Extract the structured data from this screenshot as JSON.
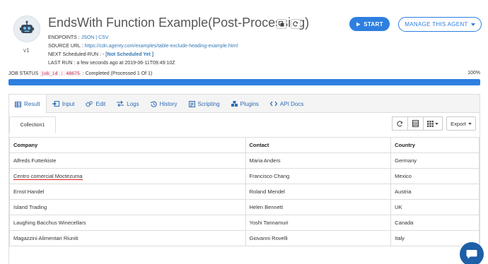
{
  "header": {
    "version": "v1",
    "title": "EndsWith Function Example(Post-Processing)",
    "endpoints_label": "ENDPOINTS :",
    "endpoints_json": "JSON",
    "endpoints_sep": " | ",
    "endpoints_csv": "CSV",
    "source_label": "SOURCE URL :",
    "source_url": "https://cdn.agenty.com/examples/table-exclude-heading-example.html",
    "next_label": "NEXT Scheduled-RUN : -",
    "next_value": "[Not Scheduled Yet ]",
    "last_label": "LAST RUN :",
    "last_value": "a few seconds ago at 2019-06-11T09:49:10Z",
    "start_label": "START",
    "manage_label": "MANAGE THIS AGENT"
  },
  "job": {
    "status_label": "JOB STATUS",
    "job_id": "job_id : 48675",
    "status_text": ": Completed (Processed 1 Of 1)",
    "percent": "100%",
    "progress": 1.0
  },
  "tabs": [
    {
      "label": "Result",
      "icon": "table-icon"
    },
    {
      "label": "Input",
      "icon": "input-icon"
    },
    {
      "label": "Edit",
      "icon": "gears-icon"
    },
    {
      "label": "Logs",
      "icon": "exchange-icon"
    },
    {
      "label": "History",
      "icon": "history-icon"
    },
    {
      "label": "Scripting",
      "icon": "script-icon"
    },
    {
      "label": "Plugins",
      "icon": "plugin-icon"
    },
    {
      "label": "API Docs",
      "icon": "code-icon"
    }
  ],
  "collection_tab": "Collection1",
  "export_label": "Export",
  "table": {
    "headers": [
      "Company",
      "Contact",
      "Country"
    ],
    "rows": [
      [
        "Alfreds Futterkiste",
        "Maria Anders",
        "Germany"
      ],
      [
        "Centro comercial Moctezuma",
        "Francisco Chang",
        "Mexico"
      ],
      [
        "Ernst Handel",
        "Roland Mendel",
        "Austria"
      ],
      [
        "Island Trading",
        "Helen Bennett",
        "UK"
      ],
      [
        "Laughing Bacchus Winecellars",
        "Yoshi Tannamuri",
        "Canada"
      ],
      [
        "Magazzini Alimentari Riuniti",
        "Giovanni Rovelli",
        "Italy"
      ]
    ]
  },
  "colors": {
    "accent": "#2d7fe0",
    "link": "#337ab7",
    "chat": "#1d5fa8"
  }
}
